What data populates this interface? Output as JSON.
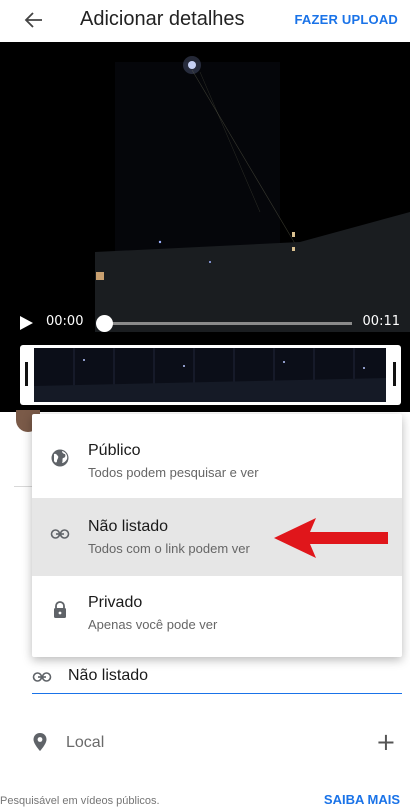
{
  "header": {
    "title": "Adicionar detalhes",
    "upload_label": "FAZER UPLOAD"
  },
  "player": {
    "current_time": "00:00",
    "total_time": "00:11",
    "progress": 0.0
  },
  "visibility_menu": {
    "options": [
      {
        "title": "Público",
        "subtitle": "Todos podem pesquisar e ver",
        "icon": "globe-icon",
        "selected": false
      },
      {
        "title": "Não listado",
        "subtitle": "Todos com o link podem ver",
        "icon": "link-icon",
        "selected": true
      },
      {
        "title": "Privado",
        "subtitle": "Apenas você pode ver",
        "icon": "lock-icon",
        "selected": false
      }
    ]
  },
  "privacy_field": {
    "value": "Não listado",
    "icon": "link-icon"
  },
  "location": {
    "label": "Local",
    "icon": "location-pin-icon",
    "action_icon": "plus-icon"
  },
  "footer": {
    "note": "Pesquisável em vídeos públicos.",
    "learn_more": "SAIBA MAIS"
  },
  "colors": {
    "accent": "#1a73e8",
    "annotation_arrow": "#e0161b",
    "selected_row": "#e6e6e6"
  }
}
